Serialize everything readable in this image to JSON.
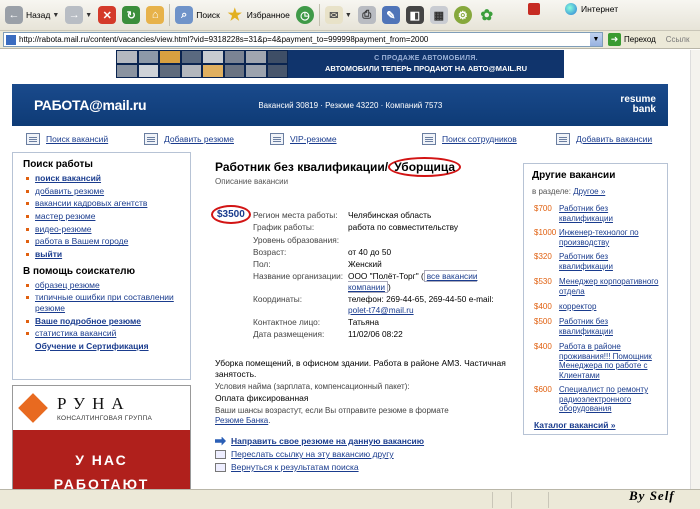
{
  "toolbar": {
    "back_label": "Назад",
    "search_label": "Поиск",
    "favorites_label": "Избранное"
  },
  "address": {
    "label": "Адрес",
    "url": "http://rabota.mail.ru/content/vacancies/view.html?vid=9318228s=31&p=4&payment_to=999998payment_from=2000",
    "go_label": "Переход",
    "links_label": "Ссылк"
  },
  "banner": {
    "top_text": "С ПРОДАЖЕ АВТОМОБИЛЯ.",
    "main_text": "АВТОМОБИЛИ ТЕПЕРЬ ПРОДАЮТ НА АВТО@MAIL.RU"
  },
  "header": {
    "logo": "РАБОТА@mail.ru",
    "stats": "Вакансий 30819  ·  Резюме 43220  ·  Компаний 7573",
    "resume_bank_1": "resume",
    "resume_bank_2": "bank"
  },
  "nav": {
    "items": [
      "Поиск вакансий",
      "Добавить резюме",
      "VIP-резюме",
      "Поиск сотрудников",
      "Добавить вакансии"
    ]
  },
  "sidebar": {
    "search_head": "Поиск работы",
    "search_items": [
      "поиск вакансий",
      "добавить резюме",
      "вакансии кадровых агентств",
      "мастер резюме",
      "видео-резюме",
      "работа в Вашем городе",
      "выйти"
    ],
    "help_head": "В помощь соискателю",
    "help_items": [
      "образец резюме",
      "типичные ошибки при составлении резюме",
      "Ваше подробное резюме",
      "статистика вакансий"
    ],
    "help_extra": "Обучение и Сертификация"
  },
  "ad": {
    "brand": "РУНА",
    "sub": "КОНСАЛТИНГОВАЯ ГРУППА",
    "line1": "У НАС",
    "line2": "РАБОТАЮТ"
  },
  "job": {
    "title_prefix": "Работник без квалификации/",
    "title_highlight": "Уборщица",
    "description_label": "Описание вакансии",
    "salary": "$3500",
    "details": [
      {
        "k": "Регион места работы:",
        "v": "Челябинская область"
      },
      {
        "k": "График работы:",
        "v": "работа по совместительству"
      },
      {
        "k": "Уровень образования:",
        "v": ""
      },
      {
        "k": "Возраст:",
        "v": "от 40 до 50"
      },
      {
        "k": "Пол:",
        "v": "Женский"
      },
      {
        "k": "Название организации:",
        "v": "ООО \"Полёт-Торг\""
      },
      {
        "k": "Координаты:",
        "v": "телефон: 269-44-65, 269-44-50 e-mail: "
      },
      {
        "k": "Контактное лицо:",
        "v": "Татьяна"
      },
      {
        "k": "Дата размещения:",
        "v": "11/02/06 08:22"
      }
    ],
    "org_link": "все вакансии компании",
    "email": "polet-t74@mail.ru",
    "duties": "Уборка помещений, в офисном здании. Работа в районе АМЗ. Частичная занятость.",
    "conditions_head": "Условия найма (зарплата, компенсационный пакет):",
    "conditions_value": "Оплата фиксированная",
    "chances_text": "Ваши шансы возрастут, если Вы отправите резюме в формате",
    "chances_link": "Резюме Банка",
    "actions": [
      "Направить свое резюме на данную вакансию",
      "Переслать ссылку на эту вакансию другу",
      "Вернуться к результатам поиска"
    ]
  },
  "other_vacancies": {
    "head": "Другие вакансии",
    "section_label": "в разделе: ",
    "section_link": "Другое »",
    "items": [
      {
        "price": "$700",
        "title": "Работник без квалификации"
      },
      {
        "price": "$1000",
        "title": "Инженер-технолог по производству"
      },
      {
        "price": "$320",
        "title": "Работник без квалификации"
      },
      {
        "price": "$530",
        "title": "Менеджер корпоративного отдела"
      },
      {
        "price": "$400",
        "title": "корректор"
      },
      {
        "price": "$500",
        "title": "Работник без квалификации"
      },
      {
        "price": "$400",
        "title": "Работа в районе проживания!!! Помощник Менеджера по работе с Клиентами"
      },
      {
        "price": "$600",
        "title": "Специалист по ремонту радиоэлектронного оборудования"
      }
    ],
    "catalog_link": "Каталог вакансий »"
  },
  "status": {
    "zone": "Интернет",
    "watermark": "By Self"
  }
}
